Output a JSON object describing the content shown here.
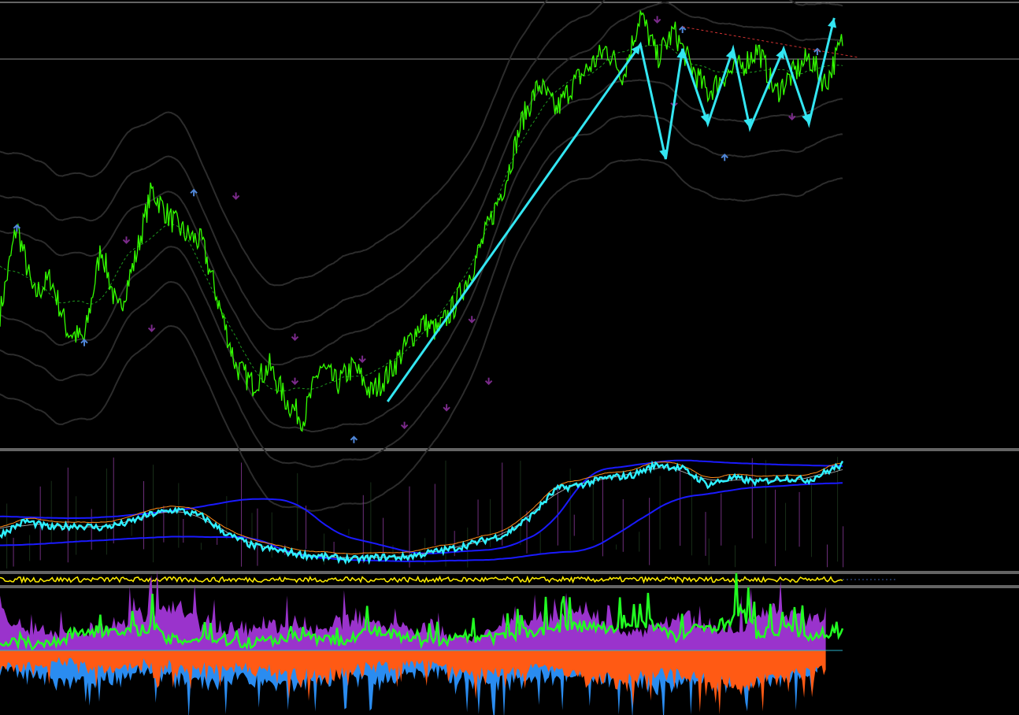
{
  "colors": {
    "background": "#000000",
    "separator": "#c8c8c8",
    "price": "#33ff00",
    "wave_arrows": "#33e6f2",
    "envelope": "#2c2c2c",
    "envelope_mid": "#1f9a1f",
    "up_fractal": "#4f86d8",
    "down_fractal": "#7a2a8a",
    "trend_line": "#d23232",
    "osc_main": "#2ef0ff",
    "osc_band": "#1a1aff",
    "osc_slow": "#ff8a1a",
    "osc_hist_a": "#1f3a1f",
    "osc_hist_b": "#8a3a9a",
    "strip_line": "#ffee00",
    "hist_green": "#22ff22",
    "hist_purple": "#9a33cc",
    "hist_orange": "#ff5a14",
    "hist_blue": "#2a8cf0"
  },
  "chart_data": [
    {
      "type": "line",
      "panel": "price",
      "ylim": [
        0,
        100
      ],
      "xlim": [
        0,
        100
      ],
      "grid": false,
      "series": [
        {
          "role": "price",
          "x": [
            0,
            2,
            4,
            6,
            8,
            10,
            12,
            14,
            16,
            18,
            20,
            22,
            24,
            26,
            28,
            30,
            32,
            34,
            36,
            38,
            40,
            42,
            44,
            46,
            48,
            50,
            52,
            54,
            56,
            58,
            60,
            62,
            64,
            66,
            68,
            70,
            72,
            74,
            76,
            78,
            80,
            82,
            84,
            86,
            88,
            90,
            92,
            94,
            96,
            98,
            100
          ],
          "y": [
            30,
            50,
            34,
            38,
            26,
            24,
            45,
            30,
            42,
            58,
            52,
            48,
            46,
            32,
            18,
            14,
            18,
            10,
            6,
            18,
            14,
            18,
            12,
            16,
            22,
            28,
            26,
            32,
            40,
            50,
            60,
            74,
            82,
            76,
            82,
            86,
            90,
            84,
            98,
            88,
            94,
            86,
            80,
            84,
            86,
            90,
            80,
            84,
            88,
            82,
            92
          ]
        },
        {
          "role": "trend-arrows",
          "x": [
            46,
            76,
            79,
            81,
            84,
            87,
            89,
            93,
            96,
            99
          ],
          "y": [
            10,
            91,
            65,
            90,
            73,
            90,
            72,
            90,
            73,
            97
          ]
        }
      ],
      "markers": {
        "up": [
          [
            2,
            50
          ],
          [
            10,
            24
          ],
          [
            23,
            58
          ],
          [
            42,
            2
          ],
          [
            81,
            95
          ],
          [
            86,
            66
          ],
          [
            97,
            90
          ]
        ],
        "down": [
          [
            15,
            46
          ],
          [
            18,
            26
          ],
          [
            28,
            56
          ],
          [
            35,
            24
          ],
          [
            35,
            14
          ],
          [
            43,
            19
          ],
          [
            48,
            4
          ],
          [
            53,
            8
          ],
          [
            56,
            28
          ],
          [
            58,
            14
          ],
          [
            78,
            96
          ],
          [
            80,
            77
          ],
          [
            94,
            74
          ]
        ]
      },
      "trend_line": [
        [
          81,
          95
        ],
        [
          102,
          88
        ]
      ]
    },
    {
      "type": "line",
      "panel": "oscillator",
      "ylim": [
        0,
        100
      ],
      "xlim": [
        0,
        100
      ],
      "series": [
        {
          "role": "osc-main",
          "x": [
            0,
            3,
            6,
            9,
            12,
            15,
            18,
            21,
            24,
            27,
            30,
            33,
            36,
            39,
            42,
            45,
            48,
            51,
            54,
            57,
            60,
            63,
            66,
            69,
            72,
            75,
            78,
            81,
            84,
            87,
            90,
            93,
            96,
            100
          ],
          "y": [
            30,
            42,
            36,
            38,
            36,
            40,
            48,
            52,
            46,
            30,
            20,
            16,
            12,
            10,
            8,
            10,
            10,
            14,
            18,
            24,
            30,
            46,
            70,
            74,
            80,
            82,
            92,
            88,
            74,
            80,
            76,
            80,
            78,
            92
          ]
        },
        {
          "role": "osc-upper-band",
          "x": [
            0,
            10,
            20,
            30,
            35,
            40,
            50,
            60,
            65,
            70,
            80,
            90,
            100
          ],
          "y": [
            46,
            44,
            50,
            62,
            60,
            30,
            12,
            18,
            34,
            86,
            96,
            92,
            90
          ]
        },
        {
          "role": "osc-lower-band",
          "x": [
            0,
            10,
            20,
            30,
            35,
            40,
            50,
            60,
            65,
            70,
            80,
            90,
            100
          ],
          "y": [
            20,
            24,
            28,
            28,
            12,
            8,
            6,
            8,
            14,
            16,
            62,
            72,
            76
          ]
        }
      ]
    },
    {
      "type": "line",
      "panel": "strip",
      "ylim": [
        0,
        100
      ],
      "xlim": [
        0,
        100
      ],
      "series": [
        {
          "role": "strip-line",
          "x": [
            0,
            100
          ],
          "y": [
            50,
            50
          ]
        }
      ]
    },
    {
      "type": "area",
      "panel": "histogram",
      "ylim": [
        -100,
        100
      ],
      "xlim": [
        0,
        100
      ],
      "series": [
        {
          "role": "hist-green",
          "x": [
            0,
            5,
            10,
            15,
            18,
            20,
            25,
            30,
            35,
            40,
            44,
            47,
            50,
            55,
            60,
            62,
            65,
            70,
            73,
            77,
            80,
            83,
            86,
            88,
            90,
            93,
            96,
            100
          ],
          "y": [
            20,
            10,
            40,
            35,
            50,
            20,
            25,
            15,
            30,
            20,
            40,
            30,
            15,
            30,
            25,
            35,
            45,
            50,
            40,
            60,
            25,
            45,
            55,
            80,
            30,
            45,
            30,
            40
          ]
        },
        {
          "role": "hist-purple",
          "x": [
            0,
            3,
            9,
            16,
            20,
            26,
            32,
            37,
            42,
            48,
            52,
            56,
            61,
            66,
            69,
            75,
            80,
            86,
            92,
            98
          ],
          "y": [
            75,
            40,
            30,
            60,
            80,
            35,
            45,
            40,
            55,
            45,
            30,
            20,
            50,
            60,
            70,
            30,
            60,
            35,
            70,
            60
          ]
        },
        {
          "role": "hist-orange",
          "x": [
            0,
            4,
            8,
            13,
            18,
            22,
            28,
            33,
            38,
            44,
            49,
            54,
            60,
            65,
            70,
            74,
            78,
            83,
            88,
            93,
            98
          ],
          "y": [
            -25,
            -30,
            -20,
            -40,
            -25,
            -35,
            -30,
            -40,
            -50,
            -30,
            -25,
            -35,
            -45,
            -30,
            -55,
            -60,
            -40,
            -50,
            -70,
            -45,
            -35
          ]
        },
        {
          "role": "hist-blue",
          "x": [
            0,
            6,
            12,
            17,
            22,
            29,
            35,
            40,
            45,
            52,
            58,
            63,
            70,
            76,
            82,
            87,
            92,
            97
          ],
          "y": [
            -30,
            -45,
            -55,
            -40,
            -60,
            -50,
            -65,
            -45,
            -55,
            -40,
            -60,
            -50,
            -45,
            -65,
            -55,
            -60,
            -50,
            -45
          ]
        }
      ]
    }
  ]
}
